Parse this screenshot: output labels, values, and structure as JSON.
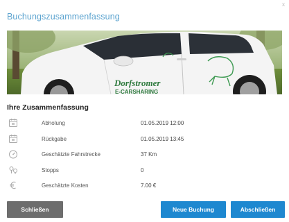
{
  "dialog": {
    "title": "Buchungszusammenfassung",
    "close_glyph": "x",
    "image": {
      "brand_text": "Dorfstromer",
      "sub_text": "E-CARSHARING"
    }
  },
  "summary": {
    "title": "Ihre Zusammenfassung",
    "rows": [
      {
        "icon": "calendar-icon",
        "label": "Abholung",
        "value": "01.05.2019 12:00"
      },
      {
        "icon": "calendar-icon",
        "label": "Rückgabe",
        "value": "01.05.2019 13:45"
      },
      {
        "icon": "speedometer-icon",
        "label": "Geschätzte Fahrstrecke",
        "value": "37 Km"
      },
      {
        "icon": "stops-icon",
        "label": "Stopps",
        "value": "0"
      },
      {
        "icon": "euro-icon",
        "label": "Geschätzte Kosten",
        "value": "7.00 €"
      }
    ]
  },
  "buttons": {
    "close": "Schließen",
    "new_booking": "Neue Buchung",
    "finish": "Abschließen"
  },
  "colors": {
    "title": "#5ba3cf",
    "primary": "#1e88d0",
    "secondary": "#6d6d6d"
  }
}
